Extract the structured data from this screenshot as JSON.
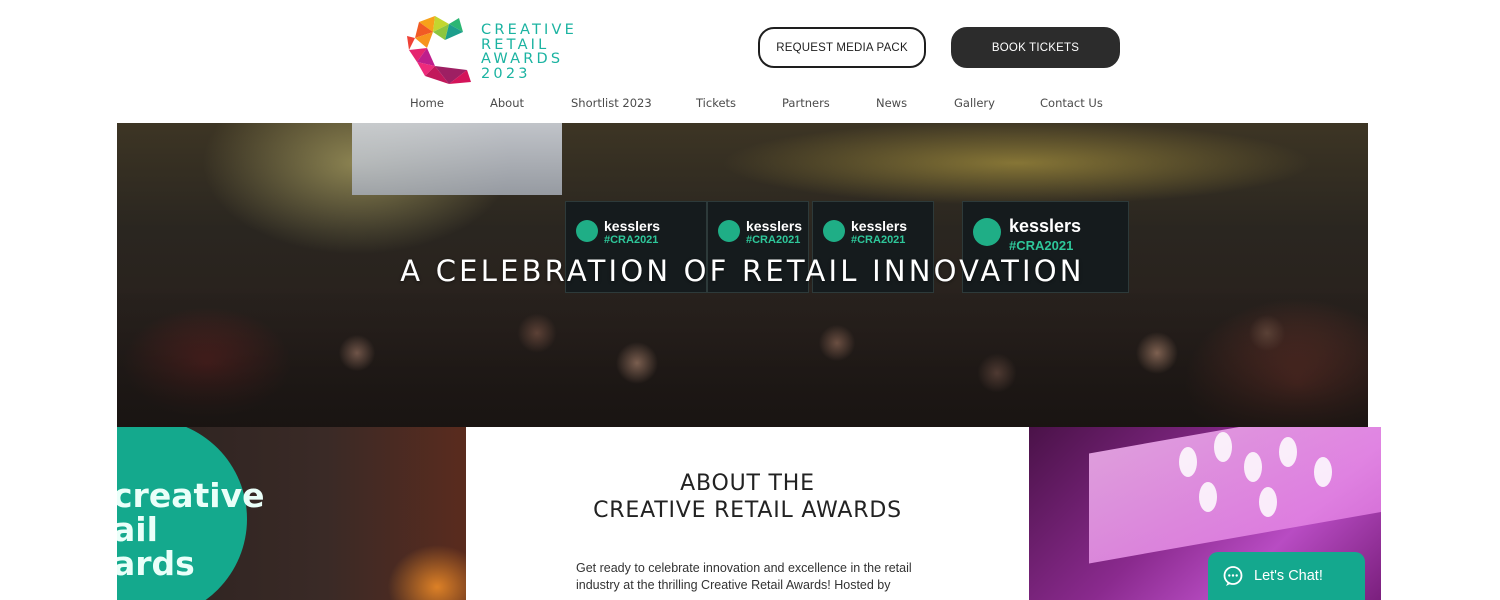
{
  "header": {
    "logo_lines": [
      "CREATIVE",
      "RETAIL",
      "AWARDS",
      "2023"
    ],
    "request_media_label": "REQUEST MEDIA PACK",
    "book_tickets_label": "BOOK TICKETS"
  },
  "nav": {
    "items": [
      "Home",
      "About",
      "Shortlist 2023",
      "Tickets",
      "Partners",
      "News",
      "Gallery",
      "Contact Us"
    ]
  },
  "hero": {
    "title": "A CELEBRATION OF RETAIL INNOVATION",
    "stand_brand": "kesslers",
    "stand_tag": "#CRA2021"
  },
  "photo_left": {
    "circle_lines": [
      "creative",
      "ail",
      "ards"
    ]
  },
  "about": {
    "title_line1": "ABOUT THE",
    "title_line2": "CREATIVE RETAIL AWARDS",
    "body": "Get ready to celebrate innovation and excellence in the retail industry at the thrilling Creative Retail Awards! Hosted by"
  },
  "chat": {
    "label": "Let's Chat!",
    "icon": "chat-bubble-icon"
  },
  "colors": {
    "brand_teal": "#1bb3a1",
    "chat_green": "#14a88e",
    "dark_button": "#2c2c2c"
  }
}
